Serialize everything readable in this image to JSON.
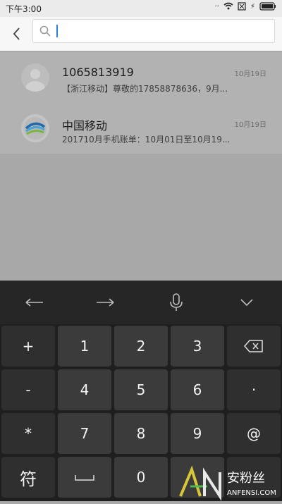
{
  "status_bar": {
    "time": "下午3:00",
    "battery_label": "⚡"
  },
  "search": {
    "placeholder": "",
    "value": ""
  },
  "messages": [
    {
      "title": "1065813919",
      "date": "10月19日",
      "snippet": "【浙江移动】尊敬的17858878636，9月..."
    },
    {
      "title": "中国移动",
      "date": "10月19日",
      "snippet": "201710月手机账单：10月01日至10月19..."
    }
  ],
  "keyboard": {
    "tools": [
      "←",
      "→",
      "mic-icon",
      "∨"
    ],
    "rows": [
      [
        "+",
        "1",
        "2",
        "3",
        "backspace-icon"
      ],
      [
        "-",
        "4",
        "5",
        "6",
        "·"
      ],
      [
        "*",
        "7",
        "8",
        "9",
        "@"
      ],
      [
        "符",
        "space-icon",
        "0",
        "",
        ""
      ]
    ]
  },
  "watermark": {
    "brand": "安粉丝",
    "url": "ANFENSI.COM"
  },
  "colors": {
    "accent": "#2a7de1",
    "keyboard_bg": "#1f1f1f",
    "key_bg": "#3b3b3b"
  }
}
